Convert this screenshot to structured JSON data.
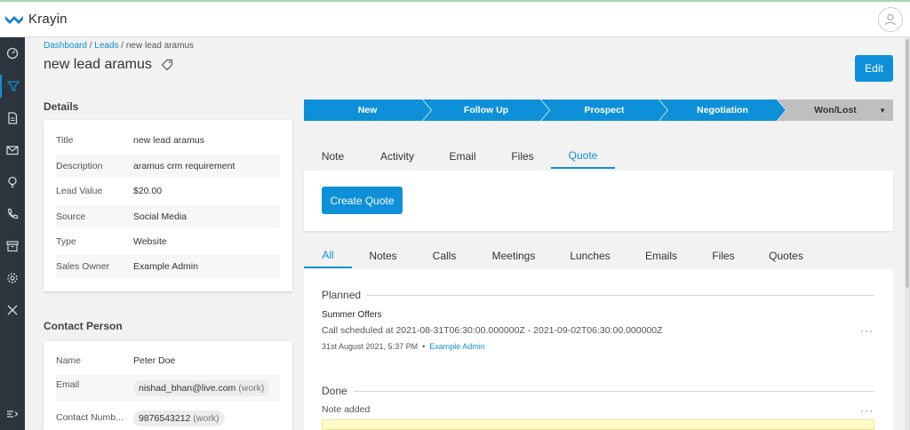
{
  "app": {
    "name": "Krayin",
    "accent_color": "#0e90d9",
    "sidebar_color": "#2c353d"
  },
  "sidebar": {
    "items": [
      {
        "icon": "dashboard-icon"
      },
      {
        "icon": "filter-icon",
        "active": true
      },
      {
        "icon": "document-icon"
      },
      {
        "icon": "mail-icon"
      },
      {
        "icon": "lightbulb-icon"
      },
      {
        "icon": "phone-icon"
      },
      {
        "icon": "archive-icon"
      },
      {
        "icon": "settings-icon"
      },
      {
        "icon": "tools-icon"
      },
      {
        "icon": "collapse-icon"
      }
    ]
  },
  "breadcrumb": {
    "dashboard": "Dashboard",
    "sep1": " / ",
    "leads": "Leads",
    "sep2": " / ",
    "current": "new lead aramus"
  },
  "page": {
    "title": "new lead aramus",
    "edit_label": "Edit"
  },
  "details": {
    "heading": "Details",
    "rows": [
      {
        "label": "Title",
        "value": "new lead aramus"
      },
      {
        "label": "Description",
        "value": "aramus crm requirement"
      },
      {
        "label": "Lead Value",
        "value": "$20.00"
      },
      {
        "label": "Source",
        "value": "Social Media"
      },
      {
        "label": "Type",
        "value": "Website"
      },
      {
        "label": "Sales Owner",
        "value": "Example Admin"
      }
    ]
  },
  "contact": {
    "heading": "Contact Person",
    "name_label": "Name",
    "name_value": "Peter Doe",
    "email_label": "Email",
    "email_value": "nishad_bhan@live.com",
    "email_tag": "(work)",
    "number_label": "Contact Numb...",
    "number_value": "9876543212",
    "number_tag": "(work)"
  },
  "pipeline": {
    "stages": [
      "New",
      "Follow Up",
      "Prospect",
      "Negotiation",
      "Won/Lost"
    ]
  },
  "action_tabs": {
    "items": [
      "Note",
      "Activity",
      "Email",
      "Files",
      "Quote"
    ],
    "active": "Quote"
  },
  "quote": {
    "create_label": "Create Quote"
  },
  "activity_tabs": {
    "items": [
      "All",
      "Notes",
      "Calls",
      "Meetings",
      "Lunches",
      "Emails",
      "Files",
      "Quotes"
    ],
    "active": "All"
  },
  "activities": {
    "planned_label": "Planned",
    "planned_item": {
      "title": "Summer Offers",
      "description": "Call scheduled at 2021-08-31T06:30:00.000000Z - 2021-09-02T06:30:00.000000Z",
      "date": "31st August 2021, 5:37 PM",
      "separator": "•",
      "user": "Example Admin",
      "more": "···"
    },
    "done_label": "Done",
    "done_item": {
      "title": "Note added",
      "more": "···"
    }
  }
}
